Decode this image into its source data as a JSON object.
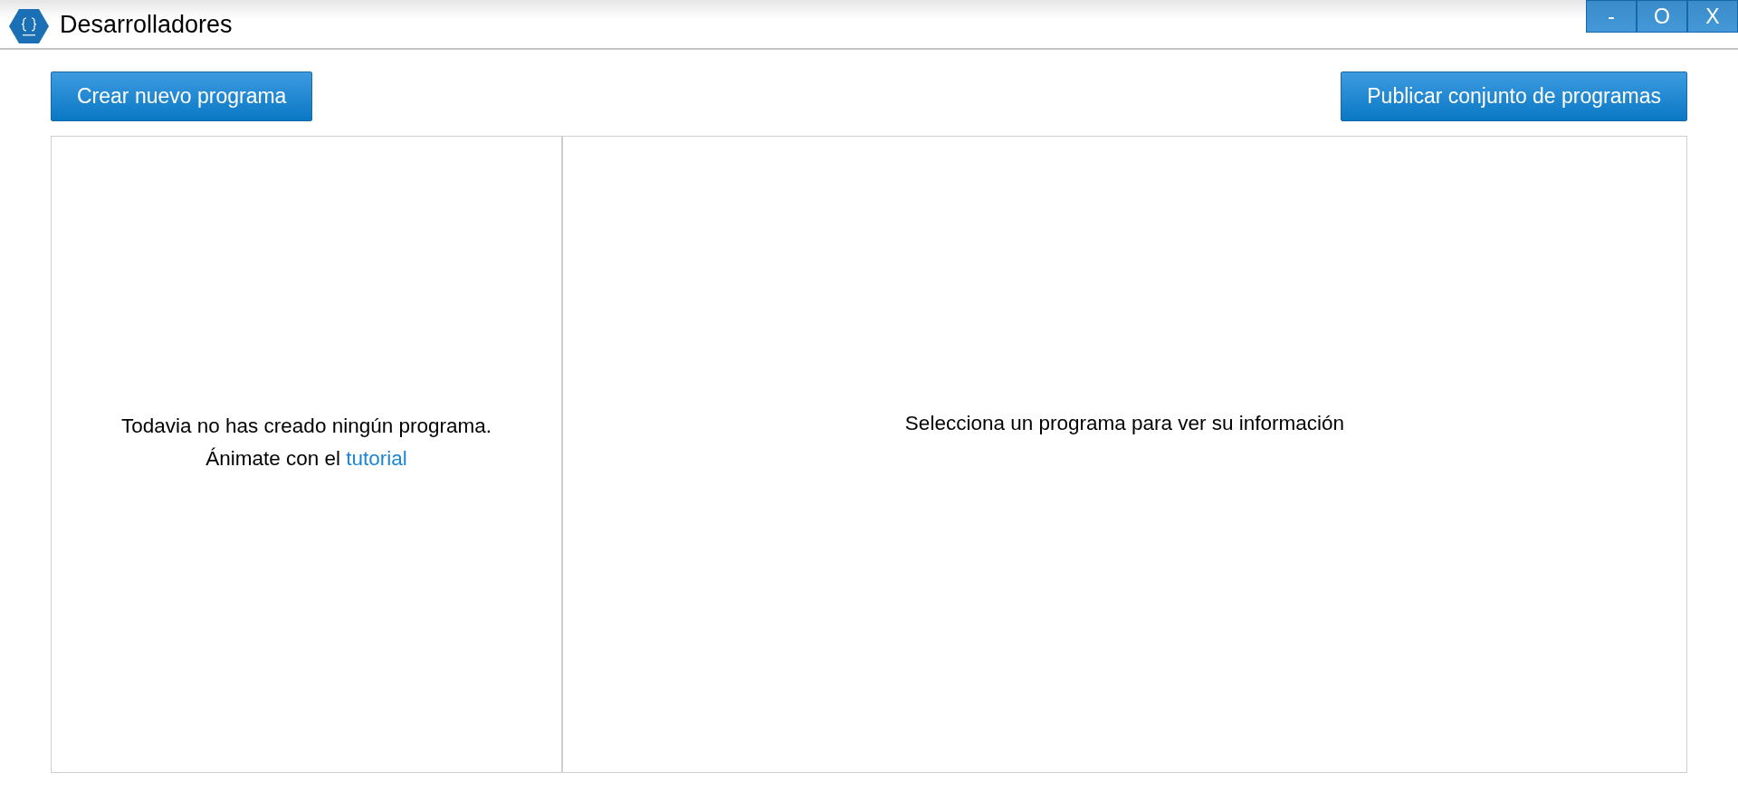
{
  "window": {
    "title": "Desarrolladores",
    "controls": [
      "-",
      "O",
      "X"
    ]
  },
  "toolbar": {
    "left_button": "Crear nuevo programa",
    "right_button": "Publicar conjunto de programas"
  },
  "program_list": {
    "empty_message": "Todavia no has creado ningún programa.",
    "prompt": "Ánimate con el ",
    "link": "tutorial"
  },
  "details": {
    "empty_message": "Selecciona un programa para ver su información"
  }
}
